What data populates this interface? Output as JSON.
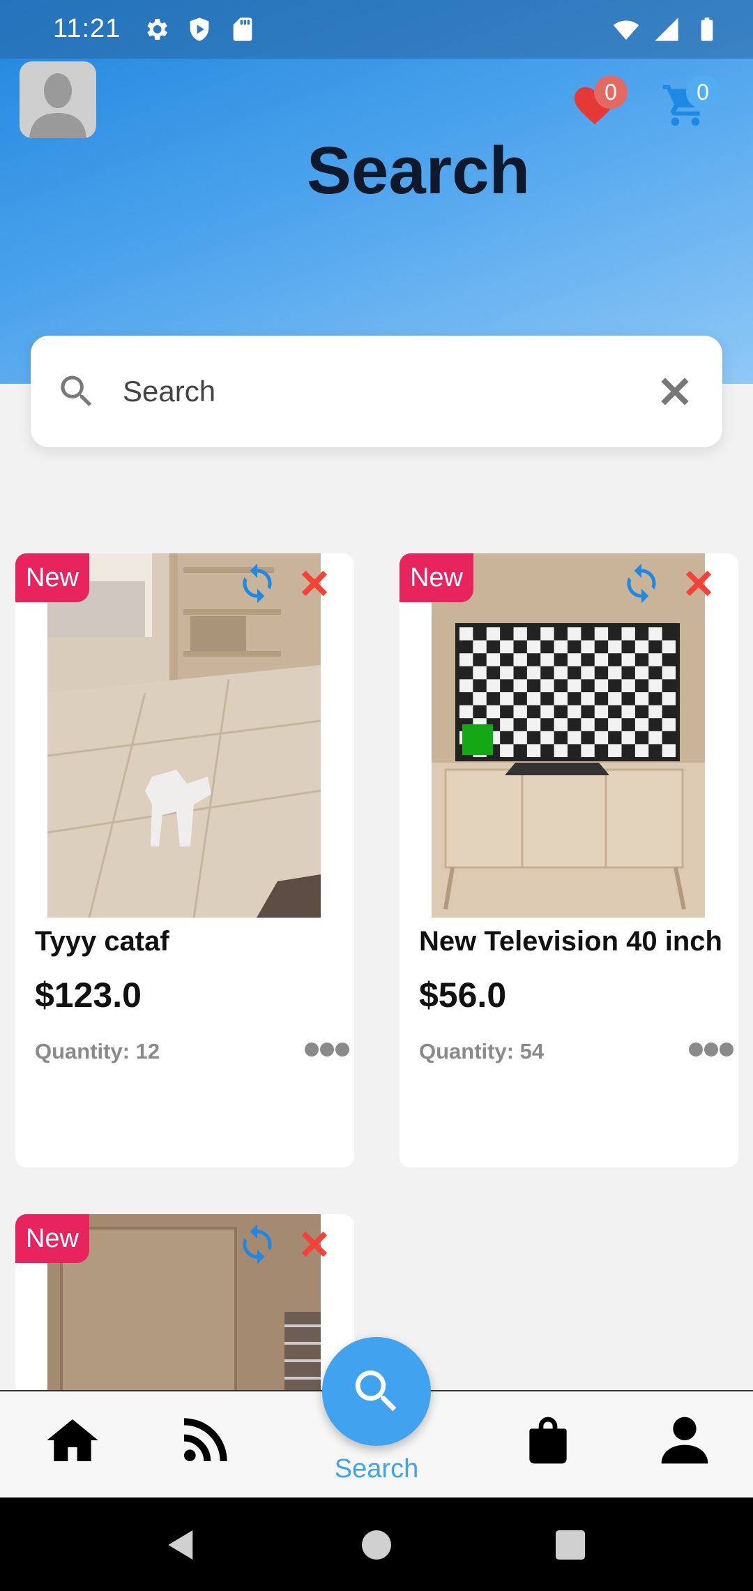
{
  "status_bar": {
    "time": "11:21",
    "left_icons": [
      "gear-icon",
      "shield-play-icon",
      "sd-card-icon"
    ],
    "right_icons": [
      "wifi-icon",
      "signal-icon",
      "battery-icon"
    ]
  },
  "header": {
    "title": "Search",
    "favorites_count": "0",
    "cart_count": "0",
    "favorites_badge_color": "#e05a5a",
    "cart_badge_color": "#4aa6f0"
  },
  "search": {
    "placeholder": "Search",
    "value": ""
  },
  "products": [
    {
      "tag": "New",
      "name": "Tyyy cataf",
      "price": "$123.0",
      "quantity": "Quantity: 12"
    },
    {
      "tag": "New",
      "name": "New Television 40 inch",
      "price": "$56.0",
      "quantity": "Quantity: 54"
    },
    {
      "tag": "New",
      "name": "",
      "price": "",
      "quantity": ""
    }
  ],
  "bottom_nav": {
    "items": [
      "home-icon",
      "feed-icon",
      "search-icon",
      "bag-icon",
      "person-icon"
    ],
    "active_label": "Search",
    "accent": "#41a3ef"
  },
  "system_nav": [
    "back-icon",
    "home-circle-icon",
    "recents-icon"
  ]
}
